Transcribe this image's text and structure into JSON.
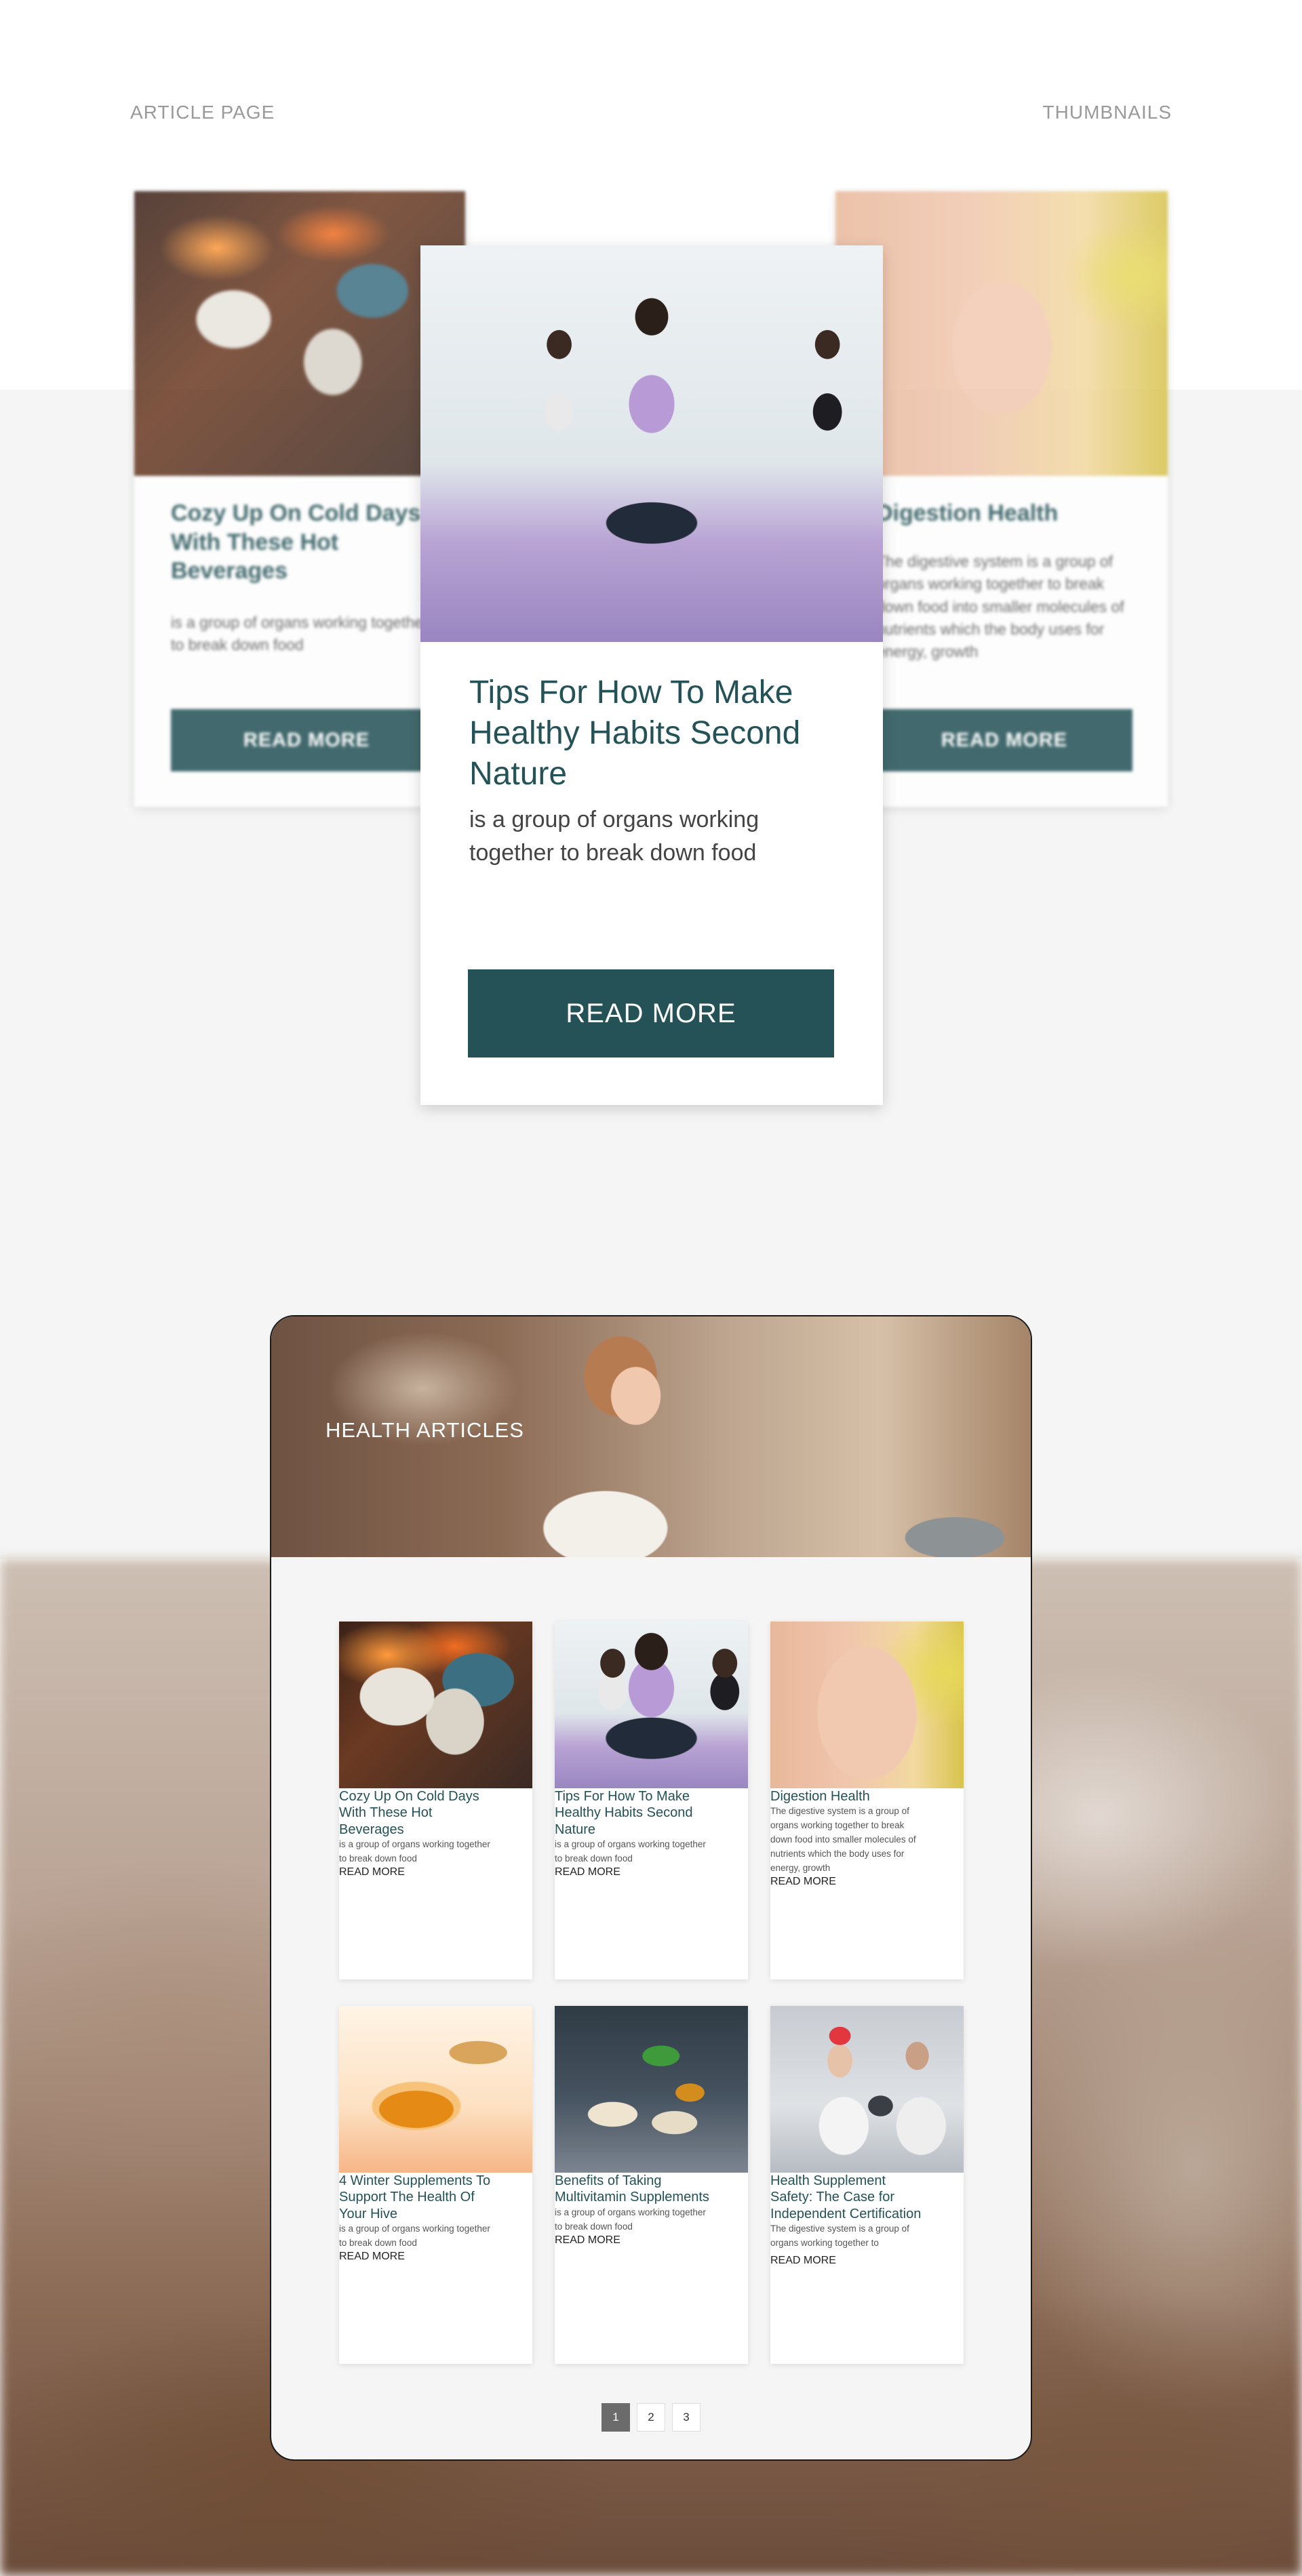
{
  "header": {
    "left_label": "ARTICLE PAGE",
    "right_label": "THUMBNAILS"
  },
  "thumbnails": {
    "left": {
      "title": "Cozy Up On Cold Days With These Hot Beverages",
      "description": "is a group of organs working together to break down food",
      "button": "READ MORE",
      "image_icon": "cocoa-mug-image"
    },
    "featured": {
      "title": "Tips For How To Make Healthy Habits Second Nature",
      "description": "is a group of organs working together to break down food",
      "button": "READ MORE",
      "image_icon": "yoga-class-image"
    },
    "right": {
      "title": "Digestion Health",
      "description": "The digestive system is a group of organs working together to break down food into smaller molecules of nutrients which the body uses for energy, growth",
      "button": "READ MORE",
      "image_icon": "belly-heart-image"
    }
  },
  "mockup": {
    "hero_title": "HEALTH ARTICLES",
    "cards": [
      {
        "title": "Cozy Up On Cold Days With These Hot Beverages",
        "description": "is a group of organs working together to break down food",
        "button": "READ MORE",
        "image_icon": "cocoa-mug-image"
      },
      {
        "title": "Tips For How To Make Healthy Habits Second Nature",
        "description": "is a group of organs working together to break down food",
        "button": "READ MORE",
        "image_icon": "yoga-class-image"
      },
      {
        "title": "Digestion Health",
        "description": "The digestive system is a group of organs working together to break down food into smaller molecules of nutrients which the body uses for energy, growth",
        "button": "READ MORE",
        "image_icon": "belly-heart-image"
      },
      {
        "title": "4 Winter Supplements To Support The Health Of Your Hive",
        "description": "is a group of organs working together to break down food",
        "button": "READ MORE",
        "image_icon": "honey-bowl-image"
      },
      {
        "title": "Benefits of Taking Multivitamin Supplements",
        "description": "is a group of organs working together to break down food",
        "button": "READ MORE",
        "image_icon": "vitamin-pills-image"
      },
      {
        "title": "Health Supplement Safety: The Case for Independent Certification",
        "description": "The digestive system is a group of organs working together to",
        "button": "READ MORE",
        "image_icon": "lab-scientists-image"
      }
    ],
    "pagination": [
      "1",
      "2",
      "3"
    ],
    "active_page": "1"
  },
  "colors": {
    "accent": "#245257",
    "grey_band": "#f4f5f4",
    "header_label": "#9a9a9a"
  }
}
